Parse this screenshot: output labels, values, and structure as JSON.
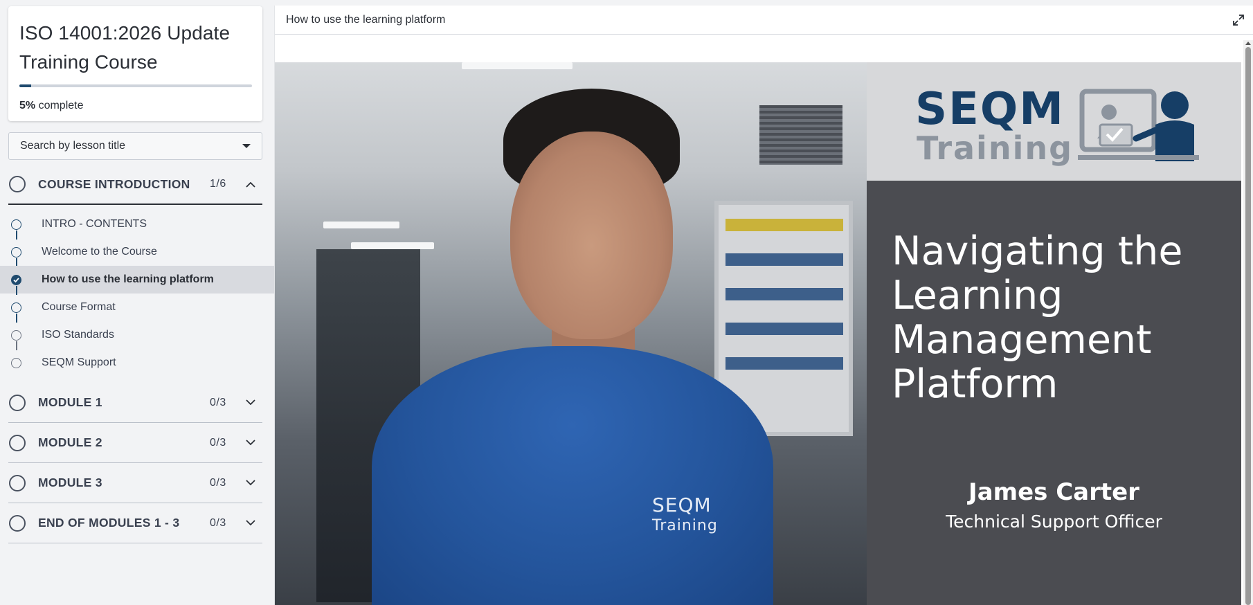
{
  "course": {
    "title": "ISO 14001:2026 Update Training Course",
    "progress_percent": 5,
    "progress_value": "5%",
    "progress_suffix": " complete"
  },
  "search": {
    "placeholder": "Search by lesson title"
  },
  "sections": [
    {
      "title": "COURSE INTRODUCTION",
      "count": "1/6",
      "expanded": true,
      "lessons": [
        {
          "label": "INTRO - CONTENTS",
          "state": "not-started"
        },
        {
          "label": "Welcome to the Course",
          "state": "not-started"
        },
        {
          "label": "How to use the learning platform",
          "state": "completed",
          "active": true
        },
        {
          "label": "Course Format",
          "state": "not-started"
        },
        {
          "label": "ISO Standards",
          "state": "not-started"
        },
        {
          "label": "SEQM Support",
          "state": "not-started"
        }
      ]
    },
    {
      "title": "MODULE 1",
      "count": "0/3",
      "expanded": false
    },
    {
      "title": "MODULE 2",
      "count": "0/3",
      "expanded": false
    },
    {
      "title": "MODULE 3",
      "count": "0/3",
      "expanded": false
    },
    {
      "title": "END OF MODULES 1 - 3",
      "count": "0/3",
      "expanded": false
    }
  ],
  "lesson_view": {
    "title": "How to use the learning platform",
    "expand_icon": "expand-icon"
  },
  "video": {
    "logo_top": "SEQM",
    "logo_bottom": "Training",
    "shirt_logo_top": "SEQM",
    "shirt_logo_bottom": "Training",
    "heading": "Navigating the Learning Management Platform",
    "presenter_name": "James Carter",
    "presenter_role": "Technical Support Officer"
  },
  "colors": {
    "accent": "#1f4a6e",
    "sidebar_bg": "#f2f3f5",
    "active_row": "#d8dadf"
  }
}
